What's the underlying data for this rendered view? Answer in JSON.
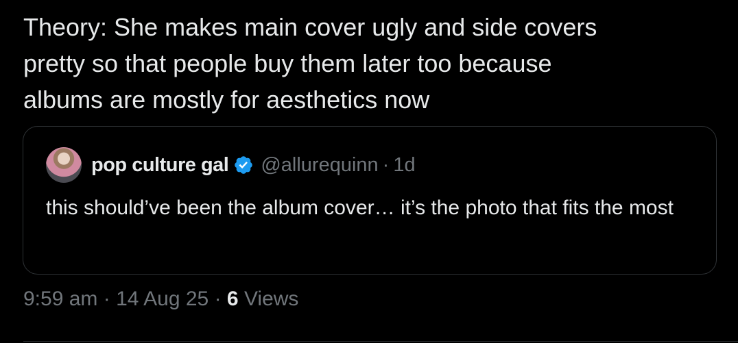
{
  "tweet": {
    "text": "Theory: She makes main cover ugly and side covers\npretty so that people buy them later too because\nalbums are mostly for aesthetics now"
  },
  "quote": {
    "display_name": "pop culture gal",
    "verified_icon": "verified-badge",
    "handle": "@allurequinn",
    "separator": "·",
    "time_ago": "1d",
    "text": "this should’ve been the album cover… it’s the photo that fits the most"
  },
  "meta": {
    "time": "9:59 am",
    "date": "14 Aug 25",
    "views_count": "6",
    "views_label": "Views",
    "separator": "·"
  },
  "colors": {
    "background": "#000000",
    "text_primary": "#e7e9ea",
    "text_secondary": "#71767b",
    "border": "#2f3336",
    "verified": "#1d9bf0"
  }
}
